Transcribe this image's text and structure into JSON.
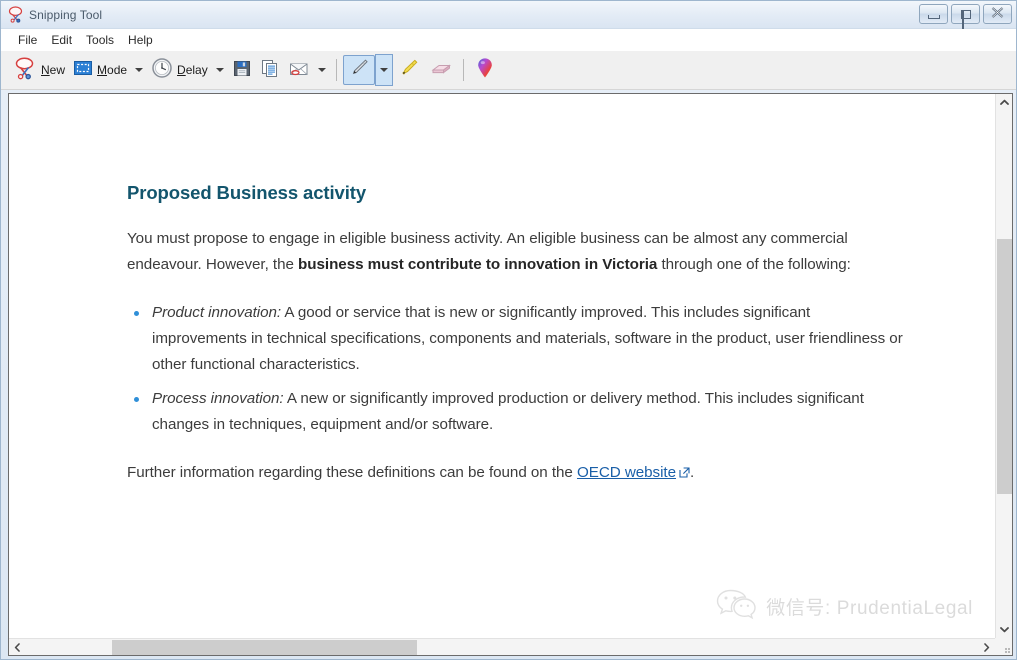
{
  "window": {
    "title": "Snipping Tool",
    "icon": "snipping-tool-icon",
    "buttons": {
      "minimize": "Minimize",
      "maximize": "Maximize",
      "close": "Close"
    }
  },
  "menu": {
    "items": [
      {
        "label": "File"
      },
      {
        "label": "Edit"
      },
      {
        "label": "Tools"
      },
      {
        "label": "Help"
      }
    ]
  },
  "toolbar": {
    "new_label": "New",
    "new_icon": "scissors-icon",
    "mode_label": "Mode",
    "mode_icon": "selection-rectangle-icon",
    "mode_dropdown": "mode-dropdown-arrow",
    "delay_label": "Delay",
    "delay_icon": "clock-icon",
    "delay_dropdown": "delay-dropdown-arrow",
    "save_icon": "floppy-disk-save-icon",
    "copy_icon": "copy-documents-icon",
    "email_icon": "envelope-email-icon",
    "email_dropdown": "email-dropdown-arrow",
    "pen_icon": "pen-icon",
    "pen_dropdown": "pen-dropdown-arrow",
    "highlighter_icon": "highlighter-icon",
    "eraser_icon": "eraser-icon",
    "pin_icon": "colored-pin-icon",
    "selected_tool": "pen"
  },
  "document": {
    "heading": "Proposed Business activity",
    "paragraph_1": {
      "part_1": "You must propose to engage in eligible business activity. An eligible business can be almost any commercial endeavour. However, the ",
      "bold": "business must contribute to innovation in Victoria",
      "part_2": " through one of the following:"
    },
    "bullets": [
      {
        "emphasis": "Product innovation:",
        "text": " A good or service that is new or significantly improved. This includes significant improvements in technical specifications, components and materials, software in the product, user friendliness or other functional characteristics."
      },
      {
        "emphasis": "Process innovation:",
        "text": " A new or significantly improved production or delivery method. This includes significant changes in techniques, equipment and/or software."
      }
    ],
    "paragraph_2": {
      "part_1": "Further information regarding these definitions can be found on the ",
      "link_text": "OECD website",
      "link_icon": "external-link-icon",
      "part_2": "."
    }
  },
  "watermark": {
    "icon": "wechat-logo-icon",
    "text": "微信号: PrudentiaLegal"
  },
  "scrollbars": {
    "vertical": {
      "up_icon": "chevron-up-icon",
      "down_icon": "chevron-down-icon",
      "thumb": "vertical-scroll-thumb"
    },
    "horizontal": {
      "left_icon": "chevron-left-icon",
      "right_icon": "chevron-right-icon",
      "thumb": "horizontal-scroll-thumb"
    }
  },
  "colors": {
    "heading": "#13556d",
    "link": "#1a5fa8",
    "bullet": "#2f8fd8",
    "body_text": "#3c3c3c",
    "toolbar_selected": "#cde3f7",
    "window_frame": "#dce7f3"
  }
}
